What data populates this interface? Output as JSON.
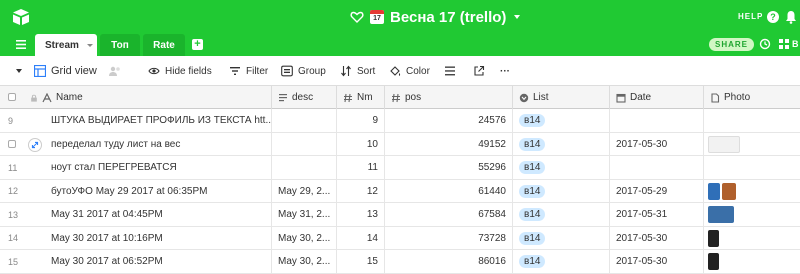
{
  "base": {
    "title": "Весна 17 (trello)",
    "calendar_day": "17"
  },
  "header_right": {
    "help_label": "HELP",
    "help_icon": "?",
    "blocks_label": "B"
  },
  "tabs": [
    {
      "label": "Stream",
      "active": true
    },
    {
      "label": "Топ",
      "active": false
    },
    {
      "label": "Rate",
      "active": false
    }
  ],
  "add_tab": "+",
  "share_label": "SHARE",
  "toolbar": {
    "view_name": "Grid view",
    "hide_fields": "Hide fields",
    "filter": "Filter",
    "group": "Group",
    "sort": "Sort",
    "color": "Color",
    "more": "···"
  },
  "columns": {
    "name": "Name",
    "desc": "desc",
    "nm": "Nm",
    "pos": "pos",
    "list": "List",
    "date": "Date",
    "photo": "Photo"
  },
  "rows": [
    {
      "rownum": "9",
      "name": "ШТУКА ВЫДИРАЕТ ПРОФИЛЬ ИЗ ТЕКСТА htt...",
      "desc": "",
      "nm": "9",
      "pos": "24576",
      "list": "в14",
      "date": "",
      "photos": 0
    },
    {
      "rownum": "",
      "name": "переделал туду лист на вес",
      "desc": "",
      "nm": "10",
      "pos": "49152",
      "list": "в14",
      "date": "2017-05-30",
      "photos": 1
    },
    {
      "rownum": "11",
      "name": "ноут стал ПЕРЕГРЕВАТСЯ",
      "desc": "",
      "nm": "11",
      "pos": "55296",
      "list": "в14",
      "date": "",
      "photos": 0
    },
    {
      "rownum": "12",
      "name": "бутоУФО May 29 2017 at 06:35PM",
      "desc": "May 29, 2...",
      "nm": "12",
      "pos": "61440",
      "list": "в14",
      "date": "2017-05-29",
      "photos": 2
    },
    {
      "rownum": "13",
      "name": "May 31 2017 at 04:45PM",
      "desc": "May 31, 2...",
      "nm": "13",
      "pos": "67584",
      "list": "в14",
      "date": "2017-05-31",
      "photos": 1
    },
    {
      "rownum": "14",
      "name": "May 30 2017 at 10:16PM",
      "desc": "May 30, 2...",
      "nm": "14",
      "pos": "73728",
      "list": "в14",
      "date": "2017-05-30",
      "photos": 1
    },
    {
      "rownum": "15",
      "name": "May 30 2017 at 06:52PM",
      "desc": "May 30, 2...",
      "nm": "15",
      "pos": "86016",
      "list": "в14",
      "date": "2017-05-30",
      "photos": 1
    }
  ],
  "colors": {
    "brand_green": "#20c933",
    "pill_blue": "#cfe9ff"
  }
}
